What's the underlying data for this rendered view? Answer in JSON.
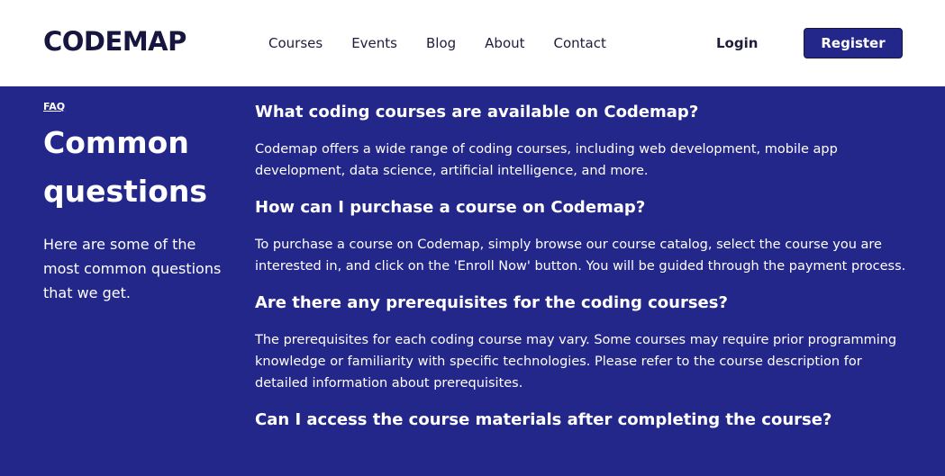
{
  "brand": {
    "logo": "CODEMAP"
  },
  "nav": {
    "links": [
      "Courses",
      "Events",
      "Blog",
      "About",
      "Contact"
    ],
    "login_label": "Login",
    "register_label": "Register"
  },
  "faq": {
    "eyebrow": "FAQ",
    "title": "Common questions",
    "intro": "Here are some of the most common questions that we get.",
    "items": [
      {
        "question": "What coding courses are available on Codemap?",
        "answer": "Codemap offers a wide range of coding courses, including web development, mobile app development, data science, artificial intelligence, and more."
      },
      {
        "question": "How can I purchase a course on Codemap?",
        "answer": "To purchase a course on Codemap, simply browse our course catalog, select the course you are interested in, and click on the 'Enroll Now' button. You will be guided through the payment process."
      },
      {
        "question": "Are there any prerequisites for the coding courses?",
        "answer": "The prerequisites for each coding course may vary. Some courses may require prior programming knowledge or familiarity with specific technologies. Please refer to the course description for detailed information about prerequisites."
      },
      {
        "question": "Can I access the course materials after completing the course?",
        "answer": ""
      }
    ]
  },
  "colors": {
    "primary": "#23278a",
    "text_dark": "#16163f",
    "white": "#ffffff"
  }
}
